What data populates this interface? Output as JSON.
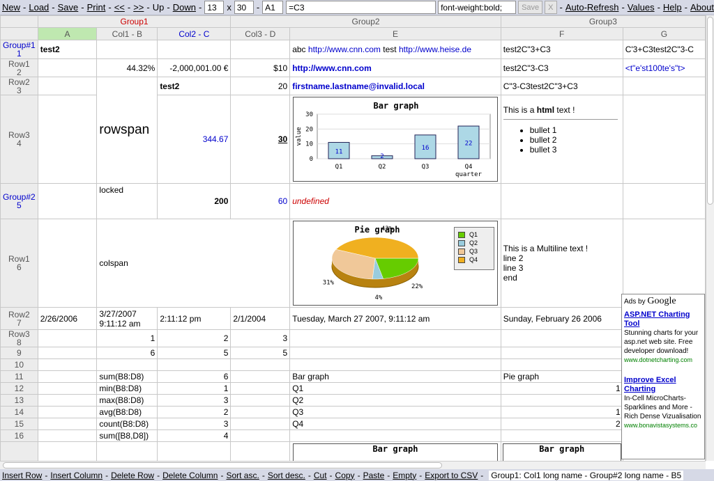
{
  "toolbar": {
    "new": "New",
    "load": "Load",
    "save": "Save",
    "print": "Print",
    "prev": "<<",
    "next": ">>",
    "up": "Up",
    "down": "Down",
    "rows": "13",
    "x": "x",
    "cols": "30",
    "cellref": "A1",
    "formula": "=C3",
    "style": "font-weight:bold;",
    "save_btn": "Save",
    "close_btn": "X",
    "autorefresh": "Auto-Refresh",
    "values": "Values",
    "help": "Help",
    "about": "About"
  },
  "groups": [
    "Group1",
    "Group2",
    "Group3"
  ],
  "columns": [
    "A",
    "Col1 - B",
    "Col2 - C",
    "Col3 - D",
    "E",
    "F",
    "G"
  ],
  "rowheaders": {
    "r1": [
      "Group#1",
      "1"
    ],
    "r2": [
      "Row1",
      "2"
    ],
    "r3": [
      "Row2",
      "3"
    ],
    "r4": [
      "Row3",
      "4"
    ],
    "r5": [
      "Group#2",
      "5"
    ],
    "r6": [
      "Row1",
      "6"
    ],
    "r7": [
      "Row2",
      "7"
    ],
    "r8": [
      "Row3",
      "8"
    ],
    "r9": "9",
    "r10": "10",
    "r11": "11",
    "r12": "12",
    "r13": "13",
    "r14": "14",
    "r15": "15",
    "r16": "16"
  },
  "cells": {
    "a1": "test2",
    "e1_pre": "abc ",
    "e1_link1": "http://www.cnn.com",
    "e1_mid": " test ",
    "e1_link2": "http://www.heise.de",
    "f1": "test2C\"3+C3",
    "g1": "C'3+C3test2C\"3-C",
    "b2": "44.32%",
    "c2": "-2,000,001.00 €",
    "d2": "$10",
    "e2": "http://www.cnn.com",
    "f2": "test2C\"3-C3",
    "g2": "<t\"e'st100te's\"t>",
    "c3": "test2",
    "d3": "20",
    "e3": "firstname.lastname@invalid.local",
    "f3": "C\"3-C3test2C\"3+C3",
    "b4": "rowspan",
    "c4": "344.67",
    "d4": "30",
    "f4_pre": "This is a ",
    "f4_b": "html",
    "f4_post": " text !",
    "bullets": [
      "bullet 1",
      "bullet 2",
      "bullet 3"
    ],
    "b5": "locked",
    "c5": "200",
    "d5": "60",
    "e5": "undefined",
    "b6": "colspan",
    "f6": [
      "This is a Multiline text !",
      "line 2",
      "line 3",
      "end"
    ],
    "a7": "2/26/2006",
    "b7": [
      "3/27/2007",
      "9:11:12 am"
    ],
    "c7": "2:11:12 pm",
    "d7": "2/1/2004",
    "e7": "Tuesday, March 27 2007, 9:11:12 am",
    "f7": "Sunday, February 26 2006",
    "b8": "1",
    "c8": "2",
    "d8": "3",
    "b9": "6",
    "c9": "5",
    "d9": "5",
    "b11": "sum(B8:D8)",
    "c11": "6",
    "e11": "Bar graph",
    "f11": "Pie graph",
    "b12": "min(B8:D8)",
    "c12": "1",
    "e12": "Q1",
    "f12": "1",
    "b13": "max(B8:D8)",
    "c13": "3",
    "e13": "Q2",
    "b14": "avg(B8:D8)",
    "c14": "2",
    "e14": "Q3",
    "f14": "1",
    "b15": "count(B8:D8)",
    "c15": "3",
    "e15": "Q4",
    "f15": "2",
    "b16": "sum([B8,D8])",
    "c16": "4",
    "e17": "Bar graph",
    "f17": "Bar graph"
  },
  "chart_data": [
    {
      "type": "bar",
      "title": "Bar graph",
      "categories": [
        "Q1",
        "Q2",
        "Q3",
        "Q4"
      ],
      "values": [
        11,
        2,
        16,
        22
      ],
      "xlabel": "quarter",
      "ylabel": "value",
      "ylim": [
        0,
        30
      ],
      "yticks": [
        "0",
        "10",
        "20",
        "30"
      ],
      "color": "#add8e6"
    },
    {
      "type": "pie",
      "title": "Pie graph",
      "categories": [
        "Q1",
        "Q2",
        "Q3",
        "Q4"
      ],
      "values": [
        22,
        4,
        31,
        43
      ],
      "labels": [
        "22%",
        "4%",
        "31%",
        "43%"
      ],
      "colors": [
        "#66cc00",
        "#99ccdd",
        "#f0c899",
        "#f0b020"
      ],
      "legend": "right"
    }
  ],
  "ads": {
    "header_pre": "Ads by ",
    "header_brand": "Google",
    "items": [
      {
        "title": "ASP.NET Charting Tool",
        "body": "Stunning charts for your asp.net web site. Free developer download!",
        "url": "www.dotnetcharting.com"
      },
      {
        "title": "Improve Excel Charting",
        "body": "In-Cell MicroCharts-Sparklines and More - Rich Dense Vizualisation",
        "url": "www.bonavistasystems.co"
      }
    ]
  },
  "bottombar": {
    "insert_row": "Insert Row",
    "insert_col": "Insert Column",
    "delete_row": "Delete Row",
    "delete_col": "Delete Column",
    "sort_asc": "Sort asc.",
    "sort_desc": "Sort desc.",
    "cut": "Cut",
    "copy": "Copy",
    "paste": "Paste",
    "empty": "Empty",
    "export": "Export to CSV",
    "status": "Group1: Col1 long name - Group#2 long name - B5"
  }
}
